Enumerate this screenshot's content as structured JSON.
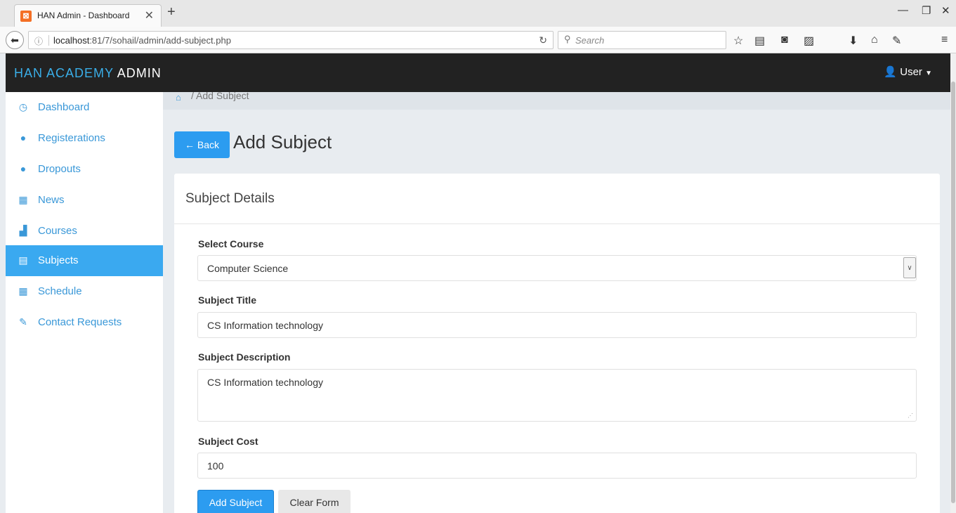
{
  "browser": {
    "tab_title": "HAN Admin - Dashboard",
    "url_host": "localhost",
    "url_rest": ":81/7/sohail/admin/add-subject.php",
    "search_placeholder": "Search"
  },
  "header": {
    "brand_part1": "HAN ACADEMY",
    "brand_part2": " ADMIN",
    "user_label": "User"
  },
  "sidebar": {
    "items": [
      {
        "label": "Dashboard",
        "icon": "dashboard-icon"
      },
      {
        "label": "Registerations",
        "icon": "user-icon"
      },
      {
        "label": "Dropouts",
        "icon": "user-icon"
      },
      {
        "label": "News",
        "icon": "grid-icon"
      },
      {
        "label": "Courses",
        "icon": "bar-chart-icon"
      },
      {
        "label": "Subjects",
        "icon": "list-icon",
        "active": true
      },
      {
        "label": "Schedule",
        "icon": "grid-icon"
      },
      {
        "label": "Contact Requests",
        "icon": "pencil-icon"
      }
    ]
  },
  "breadcrumb": {
    "current": "Add Subject"
  },
  "page": {
    "back_label": "Back",
    "title": "Add Subject"
  },
  "panel": {
    "title": "Subject Details"
  },
  "form": {
    "course_label": "Select Course",
    "course_value": "Computer Science",
    "title_label": "Subject Title",
    "title_value": "CS Information technology",
    "desc_label": "Subject Description",
    "desc_value": "CS Information technology",
    "cost_label": "Subject Cost",
    "cost_value": "100",
    "submit_label": "Add Subject",
    "clear_label": "Clear Form"
  },
  "colors": {
    "accent": "#2c9cf0",
    "header_bg": "#222222",
    "brand_blue": "#3aaee8",
    "sidebar_active": "#3aa9f0"
  }
}
